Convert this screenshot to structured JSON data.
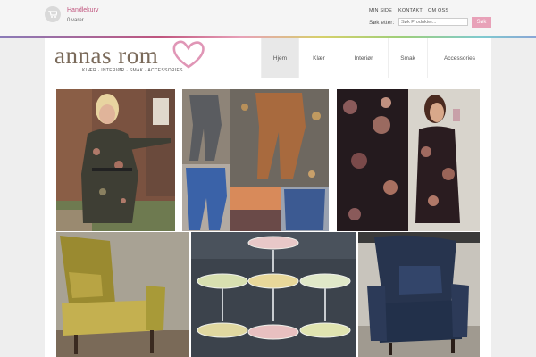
{
  "cart": {
    "label": "Handlekurv",
    "count": "0 varer",
    "icon": "cart-icon"
  },
  "toplinks": [
    "MIN SIDE",
    "KONTAKT",
    "OM OSS"
  ],
  "search": {
    "label": "Søk etter:",
    "placeholder": "Søk Produkter...",
    "button": "Søk"
  },
  "logo": {
    "text": "annas rom",
    "tagline": "KLÆR · INTERIØR · SMAK · ACCESSORIES"
  },
  "nav": [
    {
      "label": "Hjem",
      "active": true
    },
    {
      "label": "Klær",
      "active": false
    },
    {
      "label": "Interiør",
      "active": false
    },
    {
      "label": "Smak",
      "active": false
    },
    {
      "label": "Accessories",
      "active": false
    }
  ],
  "colors": {
    "accent": "#c0557e",
    "button": "#e8a1b8",
    "active_nav": "#e8e8e8"
  }
}
